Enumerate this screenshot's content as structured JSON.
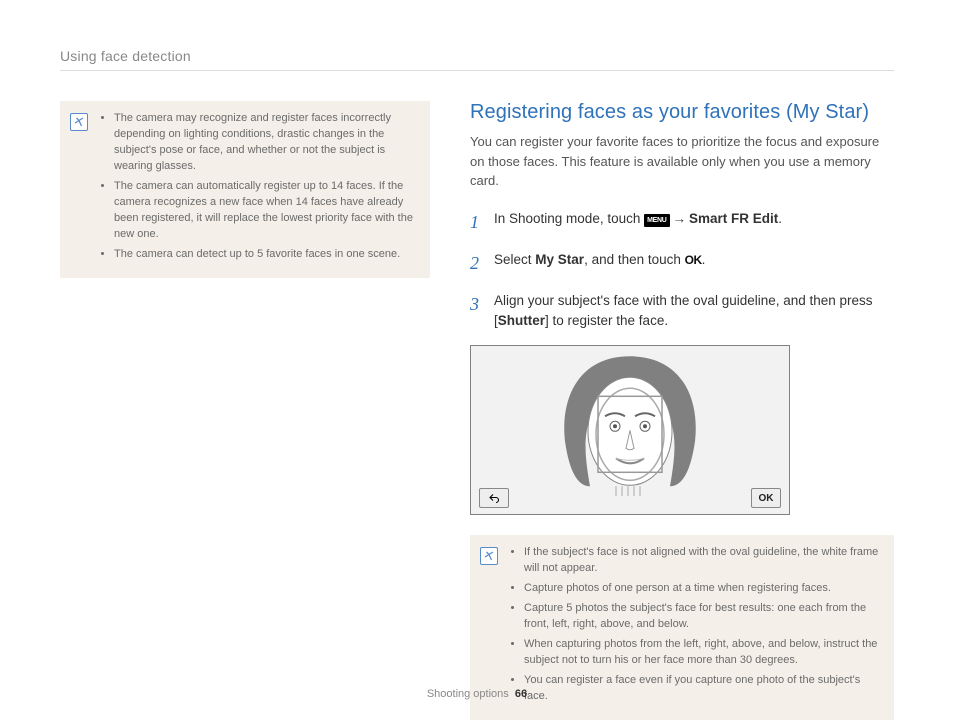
{
  "header": "Using face detection",
  "left_notes": [
    "The camera may recognize and register faces incorrectly depending on lighting conditions, drastic changes in the subject's pose or face, and whether or not the subject is wearing glasses.",
    "The camera can automatically register up to 14 faces. If the camera recognizes a new face when 14 faces have already been registered, it will replace the lowest priority face with the new one.",
    "The camera can detect up to 5 favorite faces in one scene."
  ],
  "section": {
    "title": "Registering faces as your favorites (My Star)",
    "desc": "You can register your favorite faces to prioritize the focus and exposure on those faces. This feature is available only when you use a memory card."
  },
  "steps": {
    "s1_a": "In Shooting mode, touch ",
    "menu_label": "MENU",
    "s1_b": " → ",
    "s1_c": "Smart FR Edit",
    "s1_d": ".",
    "s2_a": "Select ",
    "s2_b": "My Star",
    "s2_c": ", and then touch ",
    "ok_label": "OK",
    "s2_d": ".",
    "s3_a": "Align your subject's face with the oval guideline, and then press [",
    "s3_b": "Shutter",
    "s3_c": "] to register the face."
  },
  "illus": {
    "back_label": "↶",
    "ok_label": "OK"
  },
  "right_notes": [
    "If the subject's face is not aligned with the oval guideline, the white frame will not appear.",
    "Capture photos of one person at a time when registering faces.",
    "Capture 5 photos the subject's face for best results: one each from the front, left, right, above, and below.",
    "When capturing photos from the left, right, above, and below, instruct the subject not to turn his or her face more than 30 degrees.",
    "You can register a face even if you capture one photo of the subject's face."
  ],
  "footer": {
    "section": "Shooting options",
    "page": "66"
  }
}
